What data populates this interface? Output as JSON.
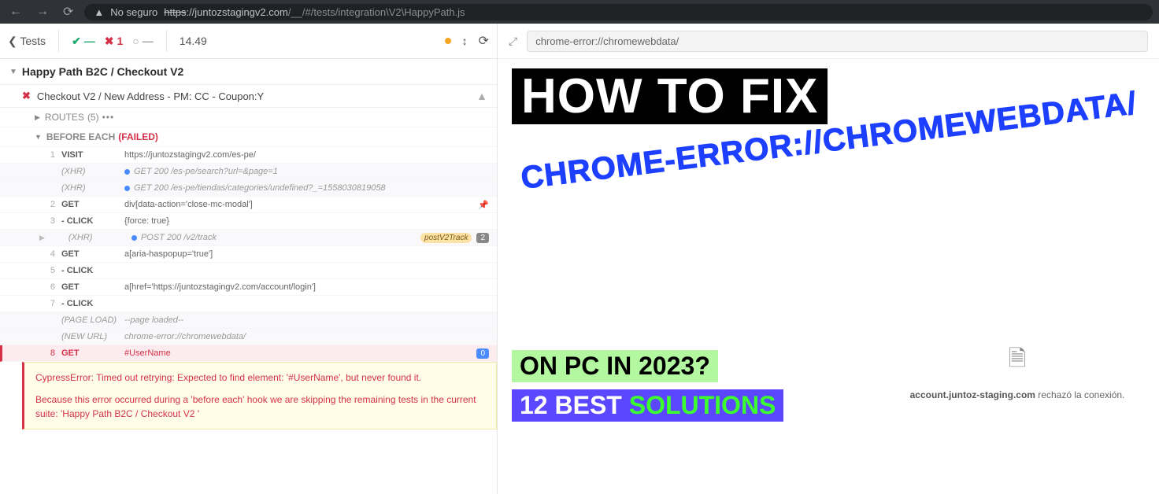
{
  "browser": {
    "insecure_label": "No seguro",
    "url_strike": "https",
    "url_main": "://juntozstagingv2.com",
    "url_dim": "/__/#/tests/integration\\V2\\HappyPath.js"
  },
  "runner": {
    "back_label": "Tests",
    "pass_count": "—",
    "fail_count": "1",
    "pending_count": "—",
    "duration": "14.49"
  },
  "suite": {
    "title": "Happy Path B2C / Checkout V2"
  },
  "test": {
    "title": "Checkout V2 / New Address - PM: CC - Coupon:Y"
  },
  "routes": {
    "label": "ROUTES",
    "count": "(5)"
  },
  "hook": {
    "label": "BEFORE EACH",
    "status": "(FAILED)"
  },
  "commands": [
    {
      "num": "1",
      "name": "VISIT",
      "msg": "https://juntozstagingv2.com/es-pe/",
      "type": "cmd"
    },
    {
      "num": "",
      "name": "(XHR)",
      "msg": "GET 200 /es-pe/search?url=&page=1",
      "type": "xhr",
      "dot": true
    },
    {
      "num": "",
      "name": "(XHR)",
      "msg": "GET 200 /es-pe/tiendas/categories/undefined?_=1558030819058",
      "type": "xhr",
      "dot": true
    },
    {
      "num": "2",
      "name": "GET",
      "msg": "div[data-action='close-mc-modal']",
      "type": "cmd",
      "pin": true
    },
    {
      "num": "3",
      "name": "- CLICK",
      "msg": "{force: true}",
      "type": "cmd"
    },
    {
      "num": "",
      "name": "(XHR)",
      "msg": "POST 200 /v2/track",
      "type": "xhr",
      "dot": true,
      "alias": "postV2Track",
      "count": "2",
      "caret": true
    },
    {
      "num": "4",
      "name": "GET",
      "msg": "a[aria-haspopup='true']",
      "type": "cmd"
    },
    {
      "num": "5",
      "name": "- CLICK",
      "msg": "",
      "type": "cmd"
    },
    {
      "num": "6",
      "name": "GET",
      "msg": "a[href='https://juntozstagingv2.com/account/login']",
      "type": "cmd"
    },
    {
      "num": "7",
      "name": "- CLICK",
      "msg": "",
      "type": "cmd"
    },
    {
      "num": "",
      "name": "(PAGE LOAD)",
      "msg": "--page loaded--",
      "type": "meta"
    },
    {
      "num": "",
      "name": "(NEW URL)",
      "msg": "chrome-error://chromewebdata/",
      "type": "meta"
    },
    {
      "num": "8",
      "name": "GET",
      "msg": "#UserName",
      "type": "err",
      "count": "0"
    }
  ],
  "error": {
    "p1": "CypressError: Timed out retrying: Expected to find element: '#UserName', but never found it.",
    "p2": "Because this error occurred during a 'before each' hook we are skipping the remaining tests in the current suite: 'Happy Path B2C / Checkout V2 '"
  },
  "preview": {
    "url": "chrome-error://chromewebdata/",
    "title": "HOW TO FIX",
    "diag": "CHROME-ERROR://CHROMEWEBDATA/",
    "question": "ON PC IN 2023?",
    "sol_prefix": "12 BEST ",
    "sol_word": "SOLUTIONS",
    "conn_domain": "account.juntoz-staging.com",
    "conn_rest": " rechazó la conexión."
  }
}
